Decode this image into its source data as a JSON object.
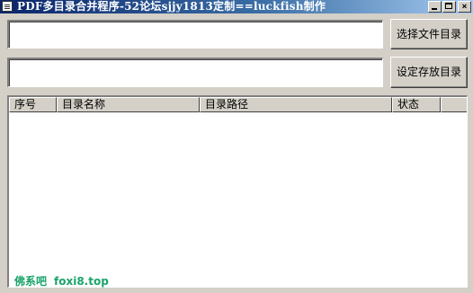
{
  "window": {
    "title": "PDF多目录合并程序-52论坛sjjy1813定制==luckfish制作",
    "controls": [
      "minimize-icon",
      "maximize-icon",
      "close-icon"
    ],
    "close_glyph": "×"
  },
  "inputs": {
    "source_dir": {
      "value": "",
      "placeholder": ""
    },
    "output_dir": {
      "value": "",
      "placeholder": ""
    }
  },
  "buttons": {
    "select_dir_label": "选择文件目录",
    "set_output_label": "设定存放目录"
  },
  "list": {
    "columns": [
      "序号",
      "目录名称",
      "目录路径",
      "状态",
      ""
    ],
    "rows": []
  },
  "watermark": {
    "line1": "佛系吧",
    "line2": "foxi8.top",
    "color": "#1aa36a"
  },
  "colors": {
    "title_gradient_start": "#0a246a",
    "title_gradient_end": "#a6caf0",
    "face": "#d4d0c8"
  }
}
